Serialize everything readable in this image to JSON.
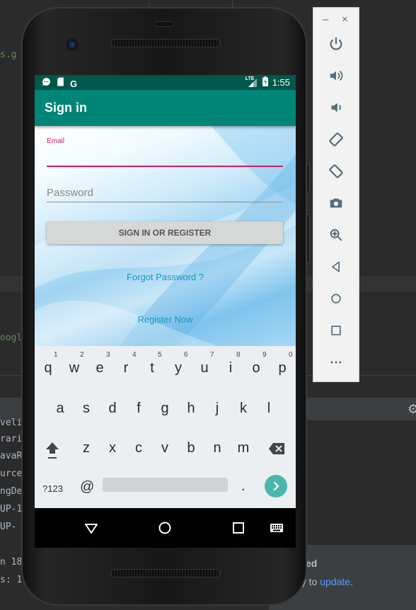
{
  "ide": {
    "code_top": "s.g",
    "code_mid": "oogl",
    "code_lines": [
      "veli",
      "rari",
      "avaR",
      "urce",
      "ngDe",
      "UP-1",
      " UP-"
    ],
    "bottom_lines": [
      "n 18",
      "s: 1"
    ],
    "notification_title": "ed",
    "notification_text": "dy to ",
    "notification_link": "update",
    "notification_end": "."
  },
  "emulator": {
    "minimize": "–",
    "close": "×",
    "buttons": [
      "power-icon",
      "volume-up-icon",
      "volume-down-icon",
      "rotate-left-icon",
      "rotate-right-icon",
      "camera-icon",
      "zoom-icon",
      "back-icon",
      "home-icon",
      "overview-icon",
      "more-icon"
    ]
  },
  "status_bar": {
    "time": "1:55",
    "network": "LTE",
    "left_icons": [
      "message-icon",
      "sd-card-icon",
      "google-icon"
    ],
    "google_letter": "G"
  },
  "app": {
    "title": "Sign in",
    "email_label": "Email",
    "email_value": "",
    "password_placeholder": "Password",
    "sign_in_button": "SIGN IN OR REGISTER",
    "forgot_password": "Forgot Password ?",
    "register_now": "Register Now",
    "accent_color": "#008577",
    "primary_dark": "#00574b",
    "pink_accent": "#d81b60"
  },
  "keyboard": {
    "row1": [
      "q",
      "w",
      "e",
      "r",
      "t",
      "y",
      "u",
      "i",
      "o",
      "p"
    ],
    "row1_digits": [
      "1",
      "2",
      "3",
      "4",
      "5",
      "6",
      "7",
      "8",
      "9",
      "0"
    ],
    "row2": [
      "a",
      "s",
      "d",
      "f",
      "g",
      "h",
      "j",
      "k",
      "l"
    ],
    "row3": [
      "z",
      "x",
      "c",
      "v",
      "b",
      "n",
      "m"
    ],
    "symbols_key": "?123",
    "at_key": "@",
    "period_key": "."
  }
}
